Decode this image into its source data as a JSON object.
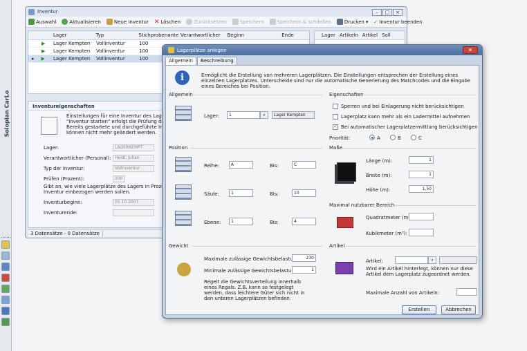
{
  "app": {
    "side_title": "Soloplan CarLo"
  },
  "main_window": {
    "title": "Inventur",
    "toolbar": [
      {
        "label": "Auswahl",
        "enabled": true,
        "icon": "filter-icon"
      },
      {
        "label": "Aktualisieren",
        "enabled": true,
        "icon": "refresh-icon"
      },
      {
        "label": "Neue Inventur",
        "enabled": true,
        "icon": "new-inventory-icon"
      },
      {
        "label": "Löschen",
        "enabled": true,
        "icon": "delete-icon"
      },
      {
        "label": "Zurücksetzen",
        "enabled": false,
        "icon": "reset-icon"
      },
      {
        "label": "Speichern",
        "enabled": false,
        "icon": "save-icon"
      },
      {
        "label": "Speichern & schließen",
        "enabled": false,
        "icon": "save-close-icon"
      },
      {
        "label": "Drucken",
        "enabled": true,
        "icon": "print-icon"
      },
      {
        "label": "Inventur beenden",
        "enabled": true,
        "icon": "finish-icon"
      }
    ],
    "grid": {
      "columns": [
        "Lager",
        "Typ",
        "Stichprobenanteil",
        "Verantwortlicher",
        "Beginn",
        "Ende"
      ],
      "rows": [
        [
          "Lager Kempten",
          "Vollinventur",
          "100"
        ],
        [
          "Lager Kempten",
          "Vollinventur",
          "100"
        ],
        [
          "Lager Kempten",
          "Vollinventur",
          "100"
        ]
      ]
    },
    "grid2": {
      "columns": [
        "Lager",
        "Artikeln",
        "Artikel",
        "Soll"
      ]
    },
    "props": {
      "title": "Inventureigenschaften",
      "desc": "Einstellungen für eine Inventur des Lagers. Mit \"Inventur starten\" erfolgt die Prüfung des Lagers. Bereits gestartete und durchgeführte Inventuren können nicht mehr geändert werden.",
      "fields": [
        {
          "label": "Lager:",
          "value": "LAGERKEMPT"
        },
        {
          "label": "Verantwortlicher (Personal):",
          "value": "Heidl, Julian"
        },
        {
          "label": "Typ der Inventur:",
          "value": "Vollinventur"
        },
        {
          "label": "Prüfen (Prozent):",
          "value": "100"
        }
      ],
      "note": "Gibt an, wie viele Lagerplätze des Lagers in Prozent in die Inventur einbezogen werden sollen.",
      "begin_label": "Inventurbeginn:",
      "begin_value": "05.10.2007",
      "end_label": "Inventurende:",
      "end_value": ""
    },
    "status": "3 Datensätze - 0 Datensätze"
  },
  "dialog": {
    "title": "Lagerplätze anlegen",
    "tabs": [
      "Allgemein",
      "Beschreibung"
    ],
    "info": "Ermöglicht die Erstellung von mehreren Lagerplätzen. Die Einstellungen entsprechen der Erstellung eines einzelnen Lagerplatzes. Unterscheide sind nur die automatische Generierung des Matchcodes und die Eingabe eines Bereiches bei Position.",
    "sec_allgemein": "Allgemein",
    "lager_label": "Lager:",
    "lager_value": "1",
    "lager_name": "Lager Kempten",
    "sec_eig": "Eigenschaften",
    "cb": [
      {
        "label": "Sperren und bei Einlagerung nicht berücksichtigen",
        "checked": false
      },
      {
        "label": "Lagerplatz kann mehr als ein Ladermittel aufnehmen",
        "checked": false
      },
      {
        "label": "Bei automatischer Lagerplatzermittlung berücksichtigen",
        "checked": true
      }
    ],
    "prio_label": "Priorität:",
    "prio": [
      "A",
      "B",
      "C"
    ],
    "prio_selected": "A",
    "sec_position": "Position",
    "pos": [
      {
        "label": "Reihe:",
        "from": "A",
        "to": "C"
      },
      {
        "label": "Säule:",
        "from": "1",
        "to": "10"
      },
      {
        "label": "Ebene:",
        "from": "1",
        "to": "4"
      }
    ],
    "bis": "Bis:",
    "sec_masse": "Maße",
    "masse": [
      {
        "label": "Länge (m):",
        "value": "1"
      },
      {
        "label": "Breite (m):",
        "value": "1"
      },
      {
        "label": "Höhe (m):",
        "value": "1,50"
      }
    ],
    "sec_max": "Maximal nutzbarer Bereich",
    "qm": "Quadratmeter (m²):",
    "km": "Kubikmeter (m³):",
    "sec_gewicht": "Gewicht",
    "g1_label": "Maximale zulässige Gewichtsbelastung (kg):",
    "g1": "230",
    "g2_label": "Minimale zulässige Gewichtsbelastung (kg):",
    "g2": "1",
    "g_note": "Regelt die Gewichtsverteilung innerhalb eines Regals. Z.B. kann so festgelegt werden, dass leichtere Güter sich nicht in den unteren Lagerplätzen befinden.",
    "sec_artikel": "Artikel",
    "art_label": "Artikel:",
    "art_note": "Wird ein Artikel hinterlegt, können nur diese Artikel dem Lagerplatz zugeordnet werden.",
    "max_art": "Maximale Anzahl von Artikeln:",
    "ok": "Erstellen",
    "cancel": "Abbrechen"
  }
}
